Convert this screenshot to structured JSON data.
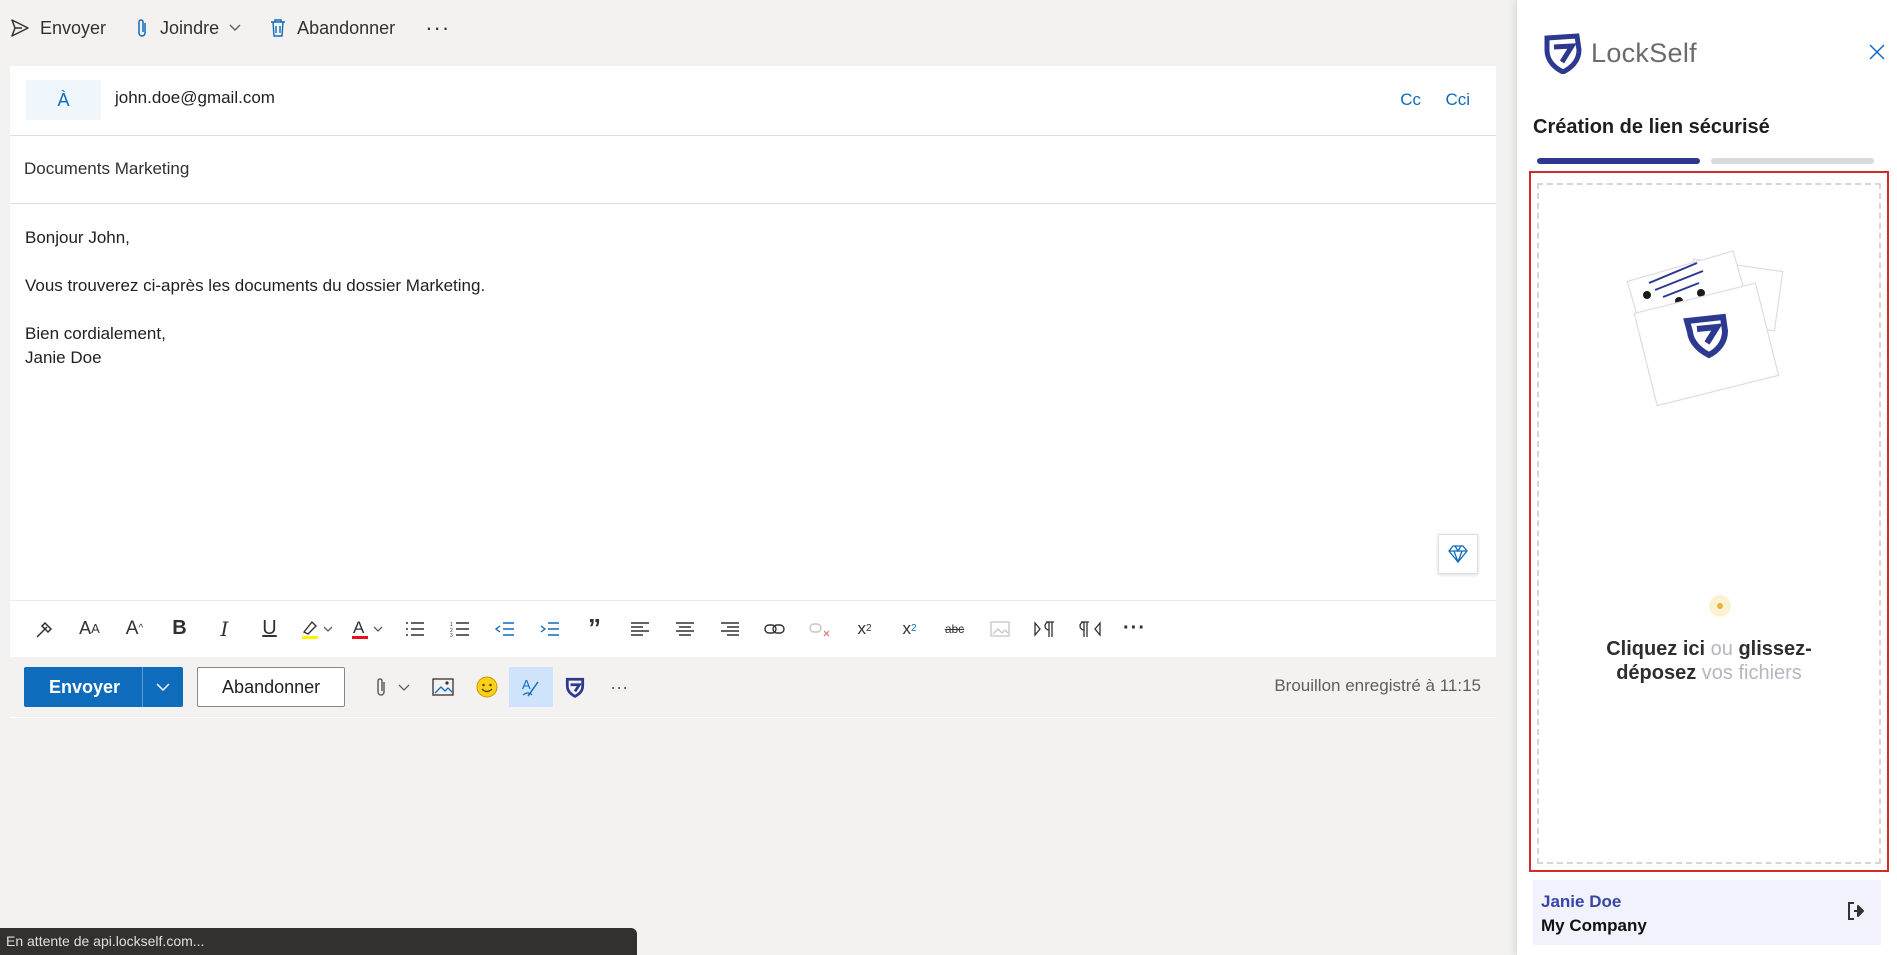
{
  "toolbar": {
    "send": "Envoyer",
    "attach": "Joindre",
    "discard": "Abandonner",
    "more": "···"
  },
  "compose": {
    "to_label": "À",
    "to_value": "john.doe@gmail.com",
    "cc": "Cc",
    "bcc": "Cci",
    "subject": "Documents Marketing",
    "body": {
      "greeting": "Bonjour John,",
      "line1": "Vous trouverez ci-après les documents du dossier Marketing.",
      "closing": "Bien cordialement,",
      "signature": "Janie Doe"
    }
  },
  "format_icons": [
    "format-painter-icon",
    "font-size-icon",
    "grow-font-icon",
    "bold-icon",
    "italic-icon",
    "underline-icon",
    "highlight-icon",
    "font-color-icon",
    "bullets-icon",
    "numbering-icon",
    "decrease-indent-icon",
    "increase-indent-icon",
    "quote-icon",
    "align-left-icon",
    "align-center-icon",
    "align-right-icon",
    "link-icon",
    "unlink-icon",
    "superscript-icon",
    "subscript-icon",
    "strikethrough-icon",
    "image-icon",
    "ltr-icon",
    "rtl-icon",
    "more-icon"
  ],
  "send_row": {
    "send": "Envoyer",
    "discard": "Abandonner",
    "draft_status": "Brouillon enregistré à 11:15",
    "more": "···"
  },
  "status_bar": "En attente de api.lockself.com...",
  "panel": {
    "brand": "LockSelf",
    "title": "Création de lien sécurisé",
    "drop": {
      "part1": "Cliquez ici",
      "part2": " ou ",
      "part3": "glissez-",
      "part4": "déposez",
      "part5": " vos fichiers"
    },
    "user": {
      "name": "Janie Doe",
      "company": "My Company"
    }
  },
  "colors": {
    "accent": "#0f6cbd",
    "brand": "#2b3990",
    "highlight_border": "#d12c2c"
  }
}
